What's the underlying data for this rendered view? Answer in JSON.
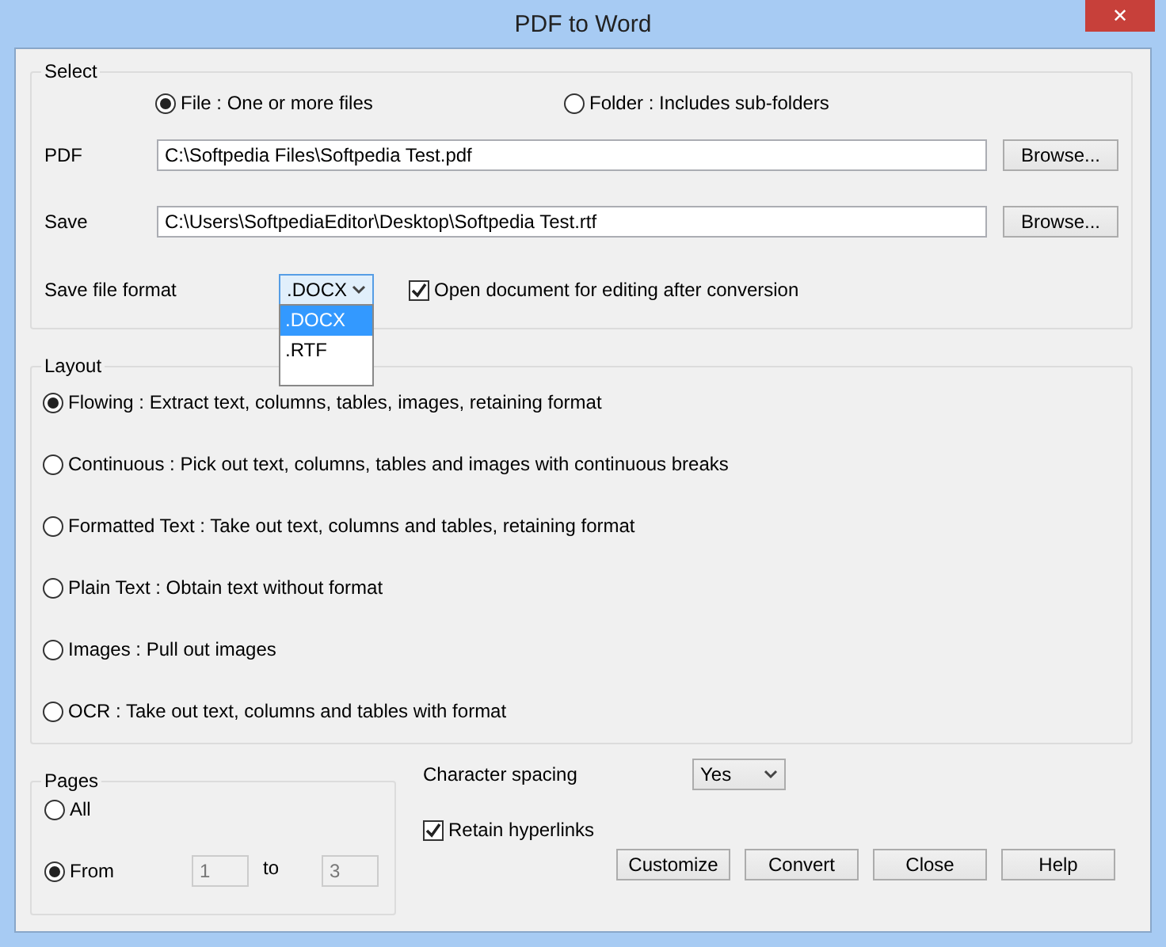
{
  "window": {
    "title": "PDF to Word",
    "close": "✕"
  },
  "select": {
    "title": "Select",
    "source": [
      {
        "label": "File :  One or more files",
        "selected": true
      },
      {
        "label": "Folder :  Includes sub-folders",
        "selected": false
      }
    ],
    "pdf": {
      "label": "PDF",
      "value": "C:\\Softpedia Files\\Softpedia Test.pdf",
      "button": "Browse..."
    },
    "save": {
      "label": "Save",
      "value": "C:\\Users\\SoftpediaEditor\\Desktop\\Softpedia Test.rtf",
      "button": "Browse..."
    },
    "format": {
      "label": "Save file format",
      "value": ".DOCX",
      "expanded": true,
      "options": [
        {
          "label": ".DOCX",
          "selected": true
        },
        {
          "label": ".RTF",
          "selected": false
        }
      ]
    },
    "open_after": {
      "label": "Open document for editing after conversion",
      "checked": true
    }
  },
  "layout": {
    "title": "Layout",
    "options": [
      {
        "label": "Flowing :  Extract text, columns, tables, images, retaining format",
        "selected": true
      },
      {
        "label": "Continuous :  Pick out text, columns, tables and images with continuous breaks",
        "selected": false
      },
      {
        "label": "Formatted Text :  Take out text, columns and tables, retaining format",
        "selected": false
      },
      {
        "label": "Plain Text :  Obtain text without format",
        "selected": false
      },
      {
        "label": "Images :  Pull out images",
        "selected": false
      },
      {
        "label": "OCR :  Take out text, columns and tables with format",
        "selected": false
      }
    ]
  },
  "pages": {
    "title": "Pages",
    "all": {
      "label": "All",
      "selected": false
    },
    "from": {
      "label": "From",
      "selected": true,
      "start": "1",
      "to_label": "to",
      "end": "3"
    }
  },
  "character_spacing": {
    "label": "Character spacing",
    "value": "Yes"
  },
  "retain_hyperlinks": {
    "label": "Retain hyperlinks",
    "checked": true
  },
  "buttons": [
    "Customize",
    "Convert",
    "Close",
    "Help"
  ]
}
